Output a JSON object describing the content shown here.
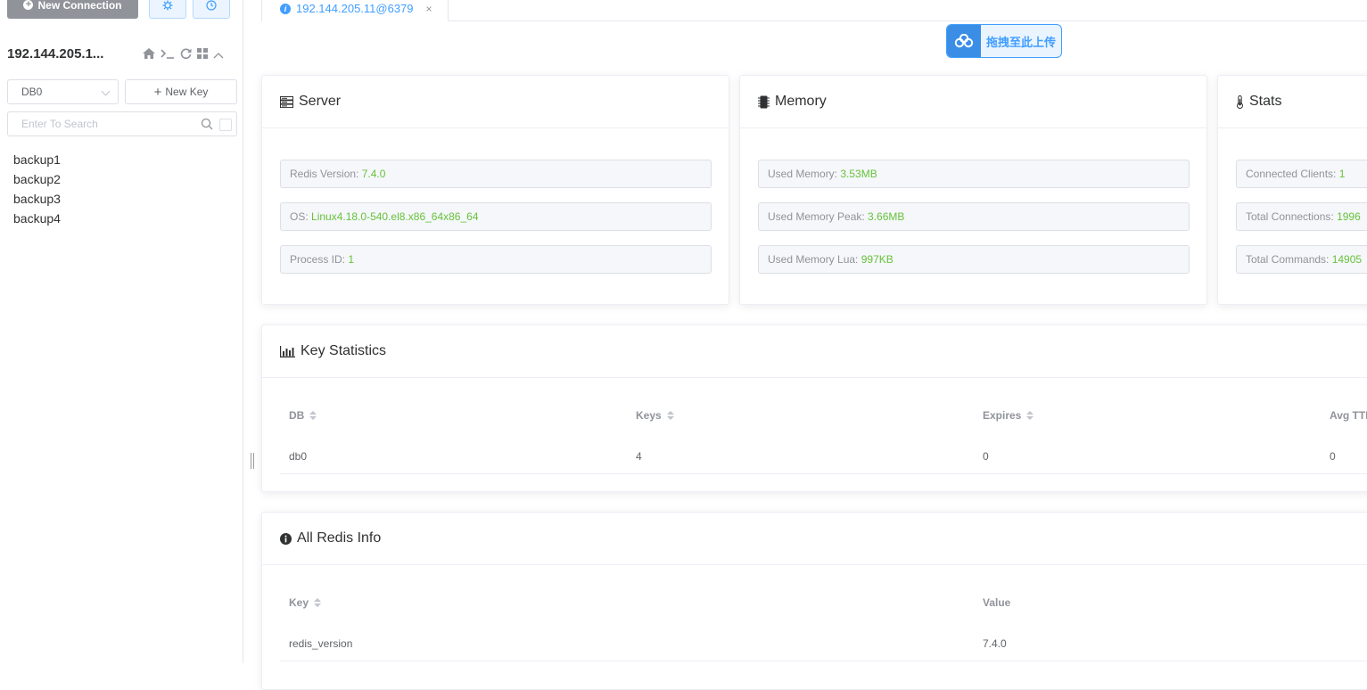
{
  "sidebar": {
    "new_connection_label": "New Connection",
    "connection_name": "192.144.205.1...",
    "db_selected": "DB0",
    "new_key_label": "New Key",
    "search_placeholder": "Enter To Search",
    "keys": [
      "backup1",
      "backup2",
      "backup3",
      "backup4"
    ]
  },
  "tab": {
    "label": "192.144.205.11@6379",
    "close": "×"
  },
  "upload": {
    "label": "拖拽至此上传"
  },
  "server": {
    "title": "Server",
    "redis_version_label": "Redis Version: ",
    "redis_version": "7.4.0",
    "os_label": "OS: ",
    "os": "Linux4.18.0-540.el8.x86_64x86_64",
    "pid_label": "Process ID: ",
    "pid": "1"
  },
  "memory": {
    "title": "Memory",
    "used_label": "Used Memory: ",
    "used": "3.53MB",
    "peak_label": "Used Memory Peak: ",
    "peak": "3.66MB",
    "lua_label": "Used Memory Lua: ",
    "lua": "997KB"
  },
  "stats": {
    "title": "Stats",
    "clients_label": "Connected Clients: ",
    "clients": "1",
    "connections_label": "Total Connections: ",
    "connections": "1996",
    "commands_label": "Total Commands: ",
    "commands": "14905"
  },
  "key_statistics": {
    "title": "Key Statistics",
    "headers": [
      "DB",
      "Keys",
      "Expires",
      "Avg TTL"
    ],
    "rows": [
      [
        "db0",
        "4",
        "0",
        "0"
      ]
    ]
  },
  "all_info": {
    "title": "All Redis Info",
    "headers": [
      "Key",
      "Value"
    ],
    "rows": [
      [
        "redis_version",
        "7.4.0"
      ]
    ]
  },
  "colors": {
    "accent": "#409eff",
    "value_green": "#67c23a",
    "gray_button": "#909399"
  }
}
